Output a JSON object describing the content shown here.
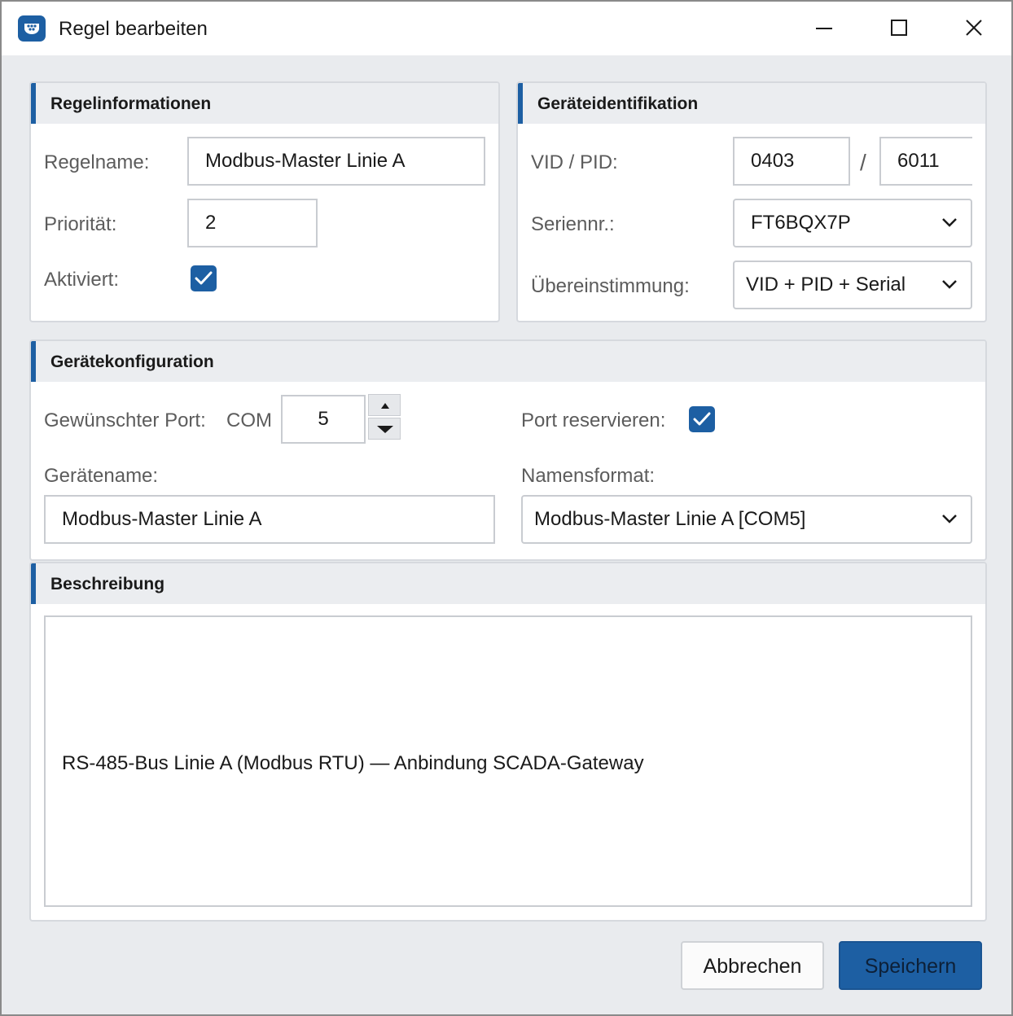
{
  "window": {
    "title": "Regel bearbeiten",
    "icons": {
      "app": "app-logo-icon",
      "minimize": "minimize-icon",
      "maximize": "maximize-icon",
      "close": "close-icon"
    }
  },
  "colors": {
    "accent": "#1d5fa3",
    "panel_header": "#ebedf0",
    "window_bg": "#e9ebee",
    "border": "#c9ccd1"
  },
  "rule_info": {
    "header": "Regelinformationen",
    "name_label": "Regelname:",
    "name_value": "Modbus-Master Linie A",
    "priority_label": "Priorität:",
    "priority_value": "2",
    "enabled_label": "Aktiviert:",
    "enabled": true
  },
  "device_id": {
    "header": "Geräteidentifikation",
    "vidpid_label": "VID / PID:",
    "vid_value": "0403",
    "separator": "/",
    "pid_value": "6011",
    "serial_label": "Seriennr.:",
    "serial_value": "FT6BQX7P",
    "match_label": "Übereinstimmung:",
    "match_value": "VID + PID + Serial"
  },
  "device_config": {
    "header": "Gerätekonfiguration",
    "port_label": "Gewünschter Port:",
    "port_prefix": "COM",
    "port_value": "5",
    "reserve_label": "Port reservieren:",
    "reserve": true,
    "devname_label": "Gerätename:",
    "devname_value": "Modbus-Master Linie A",
    "format_label": "Namensformat:",
    "format_value": "Modbus-Master Linie A [COM5]"
  },
  "description": {
    "header": "Beschreibung",
    "text": "RS-485-Bus Linie A (Modbus RTU) — Anbindung SCADA-Gateway"
  },
  "footer": {
    "cancel_label": "Abbrechen",
    "save_label": "Speichern"
  }
}
